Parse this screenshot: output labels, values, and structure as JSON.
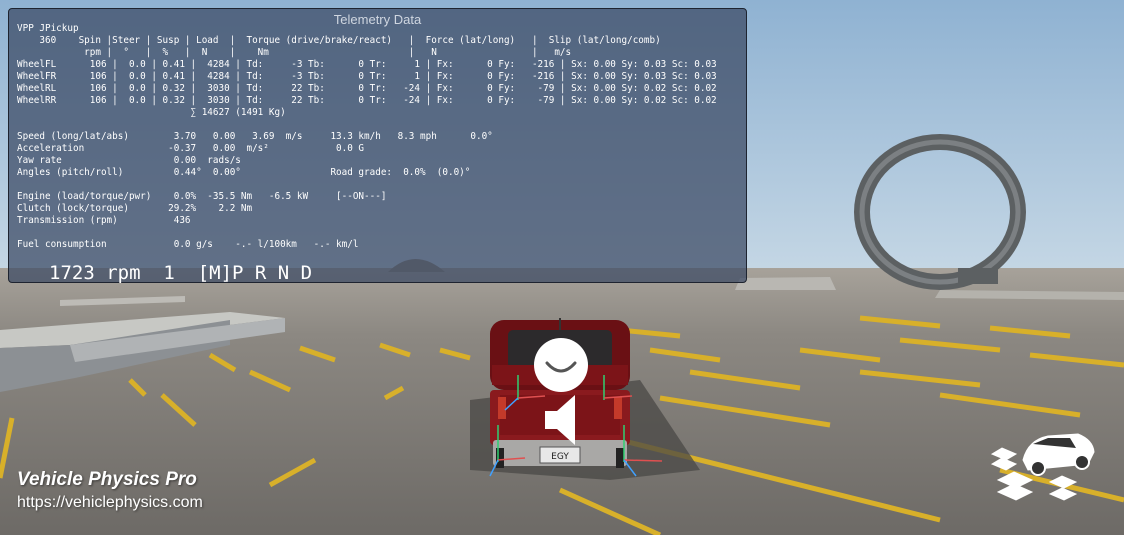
{
  "telemetry": {
    "title": "Telemetry Data",
    "lines": [
      "VPP JPickup",
      "    360    Spin |Steer | Susp | Load  |  Torque (drive/brake/react)   |  Force (lat/long)   |  Slip (lat/long/comb)",
      "            rpm |  °   |  %   |  N    |    Nm                         |   N                 |   m/s",
      "WheelFL      106 |  0.0 | 0.41 |  4284 | Td:     -3 Tb:      0 Tr:     1 | Fx:      0 Fy:   -216 | Sx: 0.00 Sy: 0.03 Sc: 0.03",
      "WheelFR      106 |  0.0 | 0.41 |  4284 | Td:     -3 Tb:      0 Tr:     1 | Fx:      0 Fy:   -216 | Sx: 0.00 Sy: 0.03 Sc: 0.03",
      "WheelRL      106 |  0.0 | 0.32 |  3030 | Td:     22 Tb:      0 Tr:   -24 | Fx:      0 Fy:    -79 | Sx: 0.00 Sy: 0.02 Sc: 0.02",
      "WheelRR      106 |  0.0 | 0.32 |  3030 | Td:     22 Tb:      0 Tr:   -24 | Fx:      0 Fy:    -79 | Sx: 0.00 Sy: 0.02 Sc: 0.02",
      "                               ∑ 14627 (1491 Kg)",
      "",
      "Speed (long/lat/abs)        3.70   0.00   3.69  m/s     13.3 km/h   8.3 mph      0.0°",
      "Acceleration               -0.37   0.00  m/s²            0.0 G",
      "Yaw rate                    0.00  rads/s",
      "Angles (pitch/roll)         0.44°  0.00°                Road grade:  0.0%  (0.0)°",
      "",
      "Engine (load/torque/pwr)    0.0%  -35.5 Nm   -6.5 kW     [--ON---]",
      "Clutch (lock/torque)       29.2%    2.2 Nm",
      "Transmission (rpm)          436",
      "",
      "Fuel consumption            0.0 g/s    -.- l/100km   -.- km/l"
    ],
    "gear_readout": "1723 rpm  1  [M]P R N D"
  },
  "branding": {
    "title": "Vehicle Physics Pro",
    "url": "https://vehiclephysics.com"
  },
  "vehicle": {
    "plate": "EGY",
    "body_color": "#7c1418"
  },
  "icons": {
    "pause": "pause-smile-icon",
    "audio": "speaker-icon",
    "camera": "car-camera-icon"
  }
}
